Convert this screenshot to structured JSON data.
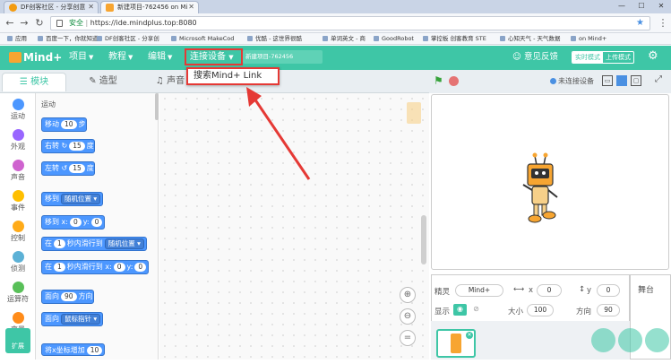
{
  "browser": {
    "tabs": [
      {
        "title": "DF创客社区 - 分享创意",
        "active": false
      },
      {
        "title": "新建项目-762456 on Mi",
        "active": true
      }
    ],
    "secure_label": "安全",
    "url": "https://ide.mindplus.top:8080",
    "bookmarks": [
      "应用",
      "百度一下，你就知道",
      "DF创客社区 - 分享创",
      "Microsoft MakeCod",
      "优酷 - 这世界很酷",
      "单词英文 - 商",
      "GoodRobot",
      "掌控板 创客教育 STE",
      "心知天气 - 天气数据",
      "on Mind+"
    ]
  },
  "app": {
    "logo": "Mind+",
    "menus": [
      "项目",
      "教程",
      "编辑"
    ],
    "connect_label": "连接设备",
    "project_name": "新建项目-762456",
    "feedback_label": "意见反馈",
    "mode_realtime": "实时模式",
    "mode_upload": "上传模式",
    "dropdown_item": "搜索Mind+ Link"
  },
  "editor_tabs": {
    "blocks": "模块",
    "costumes": "造型",
    "sounds": "声音"
  },
  "stage_toolbar": {
    "device_status": "未连接设备"
  },
  "categories": [
    {
      "label": "运动",
      "color": "#4c97ff"
    },
    {
      "label": "外观",
      "color": "#9966ff"
    },
    {
      "label": "声音",
      "color": "#cf63cf"
    },
    {
      "label": "事件",
      "color": "#ffbf00"
    },
    {
      "label": "控制",
      "color": "#ffab19"
    },
    {
      "label": "侦测",
      "color": "#5cb1d6"
    },
    {
      "label": "运算符",
      "color": "#59c059"
    },
    {
      "label": "变量",
      "color": "#ff8c1a"
    }
  ],
  "extension_label": "扩展",
  "palette": {
    "title": "运动",
    "move": {
      "a": "移动",
      "n": "10",
      "b": "步"
    },
    "turn_right": {
      "a": "右转",
      "n": "15",
      "b": "度"
    },
    "turn_left": {
      "a": "左转",
      "n": "15",
      "b": "度"
    },
    "goto": {
      "a": "移到",
      "dd": "随机位置"
    },
    "goto_xy": {
      "a": "移到 x:",
      "x": "0",
      "b": "y:",
      "y": "0"
    },
    "glide": {
      "a": "在",
      "n": "1",
      "b": "秒内滑行到",
      "dd": "随机位置"
    },
    "glide_xy": {
      "a": "在",
      "n": "1",
      "b": "秒内滑行到 x:",
      "x": "0",
      "c": "y:",
      "y": "0"
    },
    "point_dir": {
      "a": "面向",
      "n": "90",
      "b": "方向"
    },
    "point_towards": {
      "a": "面向",
      "dd": "鼠标指针"
    },
    "change_x": {
      "a": "将x坐标增加",
      "n": "10"
    }
  },
  "sprite_info": {
    "sprite_label": "精灵",
    "sprite_name": "Mind+",
    "x_label": "x",
    "x": "0",
    "y_label": "y",
    "y": "0",
    "show_label": "显示",
    "size_label": "大小",
    "size": "100",
    "direction_label": "方向",
    "direction": "90"
  },
  "stage_panel_label": "舞台",
  "zoom_reset": "="
}
